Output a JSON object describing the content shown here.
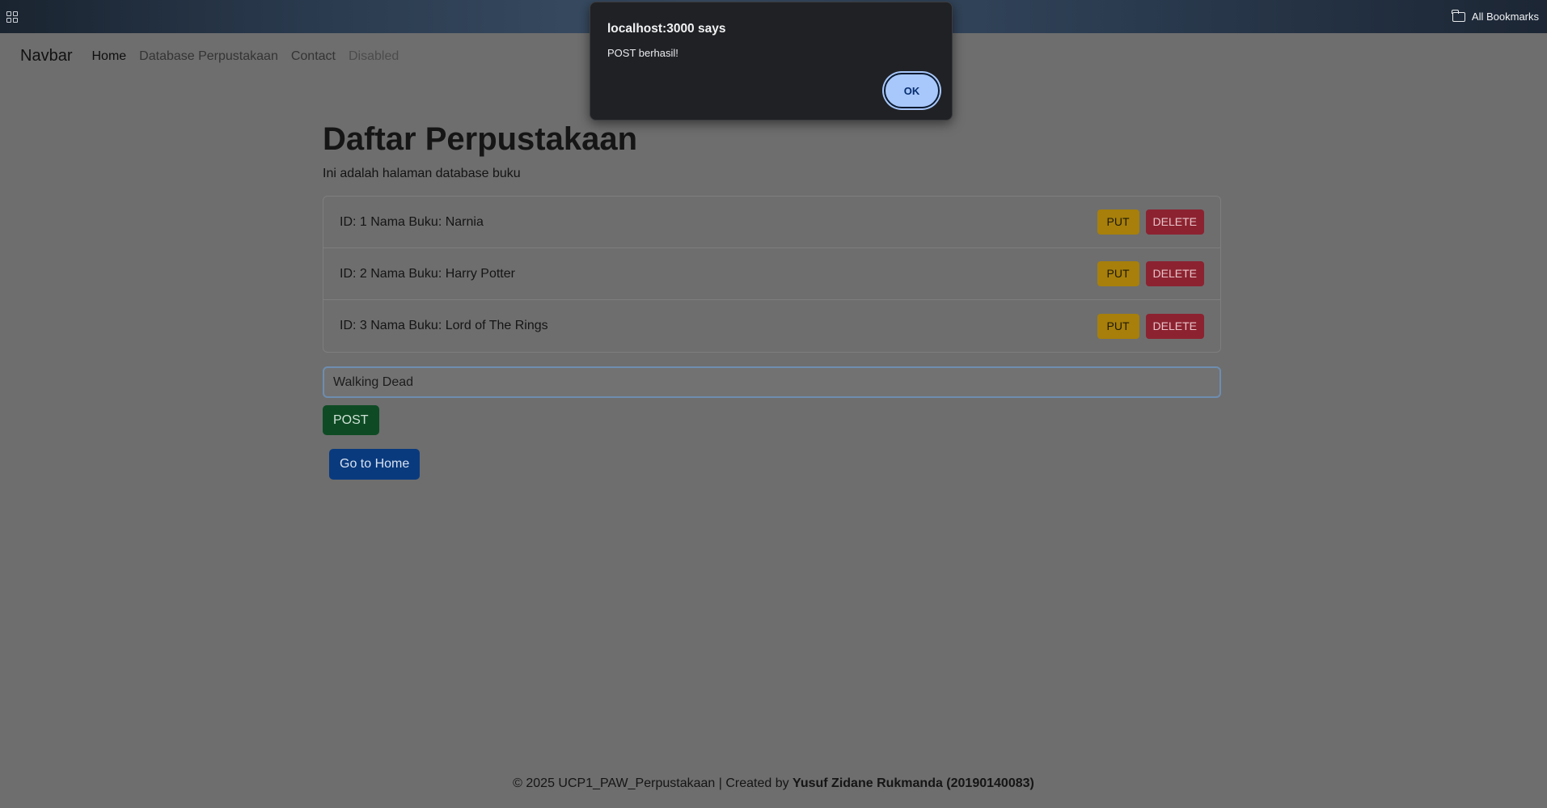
{
  "browser": {
    "bookmarks_label": "All Bookmarks"
  },
  "navbar": {
    "brand": "Navbar",
    "links": [
      "Home",
      "Database Perpustakaan",
      "Contact",
      "Disabled"
    ]
  },
  "main": {
    "title": "Daftar Perpustakaan",
    "subtitle": "Ini adalah halaman database buku",
    "books": [
      {
        "text": "ID: 1 Nama Buku: Narnia",
        "put": "PUT",
        "delete": "DELETE"
      },
      {
        "text": "ID: 2 Nama Buku: Harry Potter",
        "put": "PUT",
        "delete": "DELETE"
      },
      {
        "text": "ID: 3 Nama Buku: Lord of The Rings",
        "put": "PUT",
        "delete": "DELETE"
      }
    ],
    "input_value": "Walking Dead",
    "post_label": "POST",
    "home_label": "Go to Home"
  },
  "footer": {
    "text": "© 2025 UCP1_PAW_Perpustakaan | Created by ",
    "author": "Yusuf Zidane Rukmanda (20190140083)"
  },
  "dialog": {
    "title": "localhost:3000 says",
    "message": "POST berhasil!",
    "ok_label": "OK"
  }
}
